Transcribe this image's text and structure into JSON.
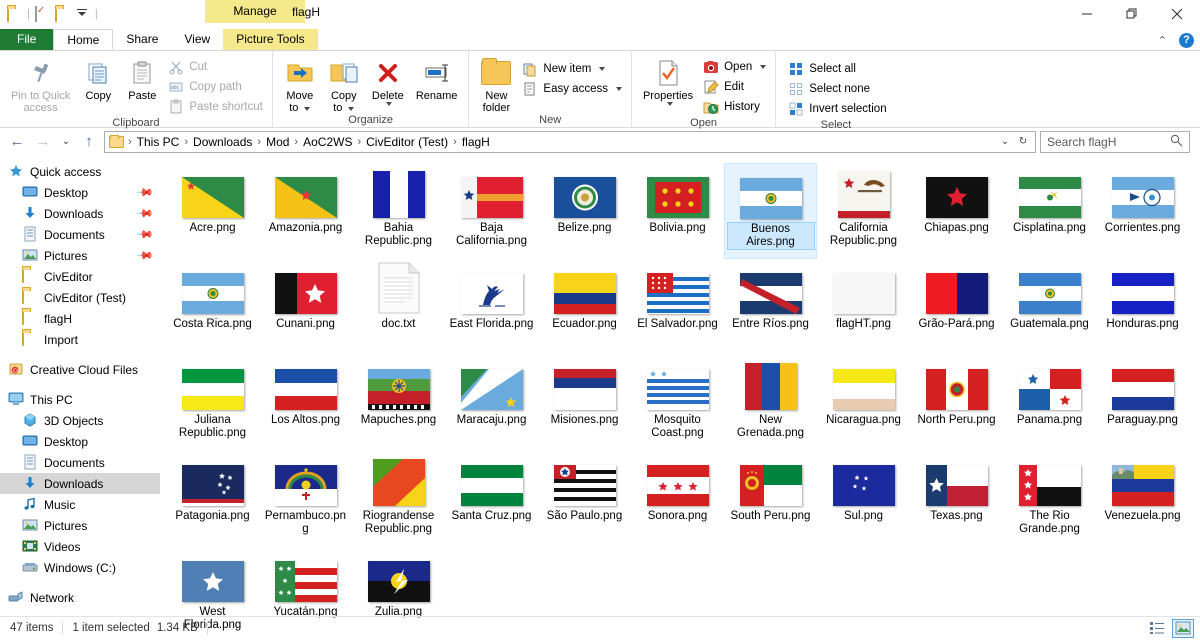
{
  "window": {
    "title": "flagH",
    "contextual_tab_group": "Picture Tools",
    "contextual_tab_label": "Manage",
    "minimize": "minimize-button",
    "restore": "restore-button",
    "close": "close-button"
  },
  "quick_access": [
    "folder-icon",
    "properties-icon",
    "new-folder-icon",
    "customize-dropdown-icon"
  ],
  "tabs": [
    {
      "label": "File"
    },
    {
      "label": "Home"
    },
    {
      "label": "Share"
    },
    {
      "label": "View"
    }
  ],
  "ribbon": {
    "groups": [
      {
        "label": "Clipboard",
        "big": [
          {
            "label": "Pin to Quick\naccess",
            "icon": "pin-icon",
            "dim": true
          },
          {
            "label": "Copy",
            "icon": "copy-icon"
          },
          {
            "label": "Paste",
            "icon": "paste-icon"
          }
        ],
        "small": [
          {
            "label": "Cut",
            "icon": "scissors-icon",
            "dim": true
          },
          {
            "label": "Copy path",
            "icon": "copy-path-icon",
            "dim": true
          },
          {
            "label": "Paste shortcut",
            "icon": "paste-shortcut-icon",
            "dim": true
          }
        ]
      },
      {
        "label": "Organize",
        "big": [
          {
            "label": "Move\nto",
            "icon": "move-to-icon",
            "caret": true
          },
          {
            "label": "Copy\nto",
            "icon": "copy-to-icon",
            "caret": true
          },
          {
            "label": "Delete",
            "icon": "delete-icon",
            "caret": true
          },
          {
            "label": "Rename",
            "icon": "rename-icon"
          }
        ],
        "small": []
      },
      {
        "label": "New",
        "big": [
          {
            "label": "New\nfolder",
            "icon": "new-folder-icon"
          }
        ],
        "small": [
          {
            "label": "New item",
            "icon": "new-item-icon",
            "caret": true
          },
          {
            "label": "Easy access",
            "icon": "easy-access-icon",
            "caret": true
          }
        ]
      },
      {
        "label": "Open",
        "big": [
          {
            "label": "Properties",
            "icon": "properties-icon",
            "caret": true
          }
        ],
        "small": [
          {
            "label": "Open",
            "icon": "open-icon",
            "caret": true
          },
          {
            "label": "Edit",
            "icon": "edit-icon"
          },
          {
            "label": "History",
            "icon": "history-icon"
          }
        ]
      },
      {
        "label": "Select",
        "big": [],
        "small": [
          {
            "label": "Select all",
            "icon": "select-all-icon"
          },
          {
            "label": "Select none",
            "icon": "select-none-icon"
          },
          {
            "label": "Invert selection",
            "icon": "invert-selection-icon"
          }
        ]
      }
    ]
  },
  "address": {
    "breadcrumbs": [
      "This PC",
      "Downloads",
      "Mod",
      "AoC2WS",
      "CivEditor (Test)",
      "flagH"
    ],
    "back": "back-button",
    "forward": "forward-button",
    "recent": "recent-locations-button",
    "up": "up-button",
    "dropdown": "address-dropdown",
    "refresh": "refresh-button"
  },
  "search": {
    "placeholder": "Search flagH",
    "icon": "search-icon"
  },
  "sidebar": {
    "sections": [
      {
        "name": "quick-access",
        "header": {
          "label": "Quick access",
          "icon": "star-icon"
        },
        "items": [
          {
            "label": "Desktop",
            "icon": "desktop-icon",
            "pinned": true
          },
          {
            "label": "Downloads",
            "icon": "downloads-icon",
            "pinned": true
          },
          {
            "label": "Documents",
            "icon": "documents-icon",
            "pinned": true
          },
          {
            "label": "Pictures",
            "icon": "pictures-icon",
            "pinned": true
          },
          {
            "label": "CivEditor",
            "icon": "folder-icon"
          },
          {
            "label": "CivEditor (Test)",
            "icon": "folder-icon"
          },
          {
            "label": "flagH",
            "icon": "folder-icon"
          },
          {
            "label": "Import",
            "icon": "folder-icon"
          }
        ]
      },
      {
        "name": "creative-cloud",
        "header": {
          "label": "Creative Cloud Files",
          "icon": "creative-cloud-icon"
        },
        "items": []
      },
      {
        "name": "this-pc",
        "header": {
          "label": "This PC",
          "icon": "computer-icon"
        },
        "items": [
          {
            "label": "3D Objects",
            "icon": "3d-objects-icon"
          },
          {
            "label": "Desktop",
            "icon": "desktop-icon"
          },
          {
            "label": "Documents",
            "icon": "documents-icon"
          },
          {
            "label": "Downloads",
            "icon": "downloads-icon",
            "selected": true
          },
          {
            "label": "Music",
            "icon": "music-icon"
          },
          {
            "label": "Pictures",
            "icon": "pictures-icon"
          },
          {
            "label": "Videos",
            "icon": "videos-icon"
          },
          {
            "label": "Windows (C:)",
            "icon": "drive-icon"
          }
        ]
      },
      {
        "name": "network",
        "header": {
          "label": "Network",
          "icon": "network-icon"
        },
        "items": []
      }
    ]
  },
  "files": [
    {
      "name": "Acre.png",
      "type": "image"
    },
    {
      "name": "Amazonia.png",
      "type": "image"
    },
    {
      "name": "Bahia Republic.png",
      "type": "image"
    },
    {
      "name": "Baja California.png",
      "type": "image"
    },
    {
      "name": "Belize.png",
      "type": "image"
    },
    {
      "name": "Bolivia.png",
      "type": "image"
    },
    {
      "name": "Buenos Aires.png",
      "type": "image",
      "selected": true
    },
    {
      "name": "California Republic.png",
      "type": "image"
    },
    {
      "name": "Chiapas.png",
      "type": "image"
    },
    {
      "name": "Cisplatina.png",
      "type": "image"
    },
    {
      "name": "Corrientes.png",
      "type": "image"
    },
    {
      "name": "Costa Rica.png",
      "type": "image"
    },
    {
      "name": "Cunani.png",
      "type": "image"
    },
    {
      "name": "doc.txt",
      "type": "text"
    },
    {
      "name": "East Florida.png",
      "type": "image"
    },
    {
      "name": "Ecuador.png",
      "type": "image"
    },
    {
      "name": "El Salvador.png",
      "type": "image"
    },
    {
      "name": "Entre Ríos.png",
      "type": "image"
    },
    {
      "name": "flagHT.png",
      "type": "image"
    },
    {
      "name": "Grão-Pará.png",
      "type": "image"
    },
    {
      "name": "Guatemala.png",
      "type": "image"
    },
    {
      "name": "Honduras.png",
      "type": "image"
    },
    {
      "name": "Juliana Republic.png",
      "type": "image"
    },
    {
      "name": "Los Altos.png",
      "type": "image"
    },
    {
      "name": "Mapuches.png",
      "type": "image"
    },
    {
      "name": "Maracaju.png",
      "type": "image"
    },
    {
      "name": "Misiones.png",
      "type": "image"
    },
    {
      "name": "Mosquito Coast.png",
      "type": "image"
    },
    {
      "name": "New Grenada.png",
      "type": "image"
    },
    {
      "name": "Nicaragua.png",
      "type": "image"
    },
    {
      "name": "North Peru.png",
      "type": "image"
    },
    {
      "name": "Panama.png",
      "type": "image"
    },
    {
      "name": "Paraguay.png",
      "type": "image"
    },
    {
      "name": "Patagonia.png",
      "type": "image"
    },
    {
      "name": "Pernambuco.png",
      "type": "image"
    },
    {
      "name": "Riograndense Republic.png",
      "type": "image"
    },
    {
      "name": "Santa Cruz.png",
      "type": "image"
    },
    {
      "name": "São Paulo.png",
      "type": "image"
    },
    {
      "name": "Sonora.png",
      "type": "image"
    },
    {
      "name": "South Peru.png",
      "type": "image"
    },
    {
      "name": "Sul.png",
      "type": "image"
    },
    {
      "name": "Texas.png",
      "type": "image"
    },
    {
      "name": "The Rio Grande.png",
      "type": "image"
    },
    {
      "name": "Venezuela.png",
      "type": "image"
    },
    {
      "name": "West Florida.png",
      "type": "image"
    },
    {
      "name": "Yucatán.png",
      "type": "image"
    },
    {
      "name": "Zulia.png",
      "type": "image"
    }
  ],
  "status": {
    "item_count": "47 items",
    "selection": "1 item selected",
    "size": "1.34 KB",
    "view_details": "details-view-button",
    "view_large_icons": "large-icons-view-button"
  }
}
